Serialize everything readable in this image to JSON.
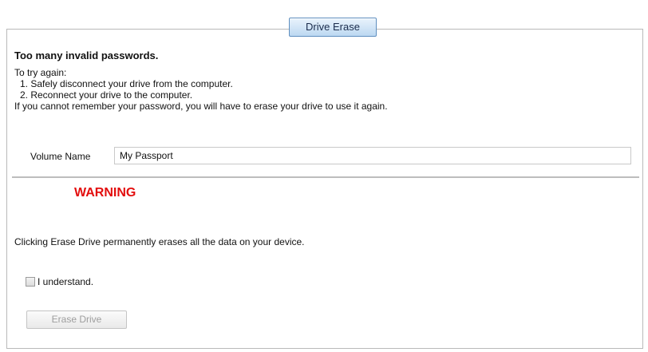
{
  "dialog": {
    "tab_label": "Drive Erase",
    "title": "Too many invalid passwords.",
    "intro": "To try again:",
    "steps": [
      "1. Safely disconnect your drive from the computer.",
      "2. Reconnect your drive to the computer."
    ],
    "forgot_note": "If you cannot remember your password, you will have to erase your drive to use it again."
  },
  "volume": {
    "label": "Volume Name",
    "value": "My Passport"
  },
  "warning": {
    "heading": "WARNING",
    "text": "Clicking Erase Drive permanently erases all the data on your device.",
    "checkbox_label": "I understand.",
    "checkbox_checked": false
  },
  "actions": {
    "erase_label": "Erase Drive",
    "erase_enabled": false
  },
  "colors": {
    "warning": "#e30e0e",
    "tab_border": "#5f8fbf",
    "disabled_text": "#9e9e9e"
  }
}
